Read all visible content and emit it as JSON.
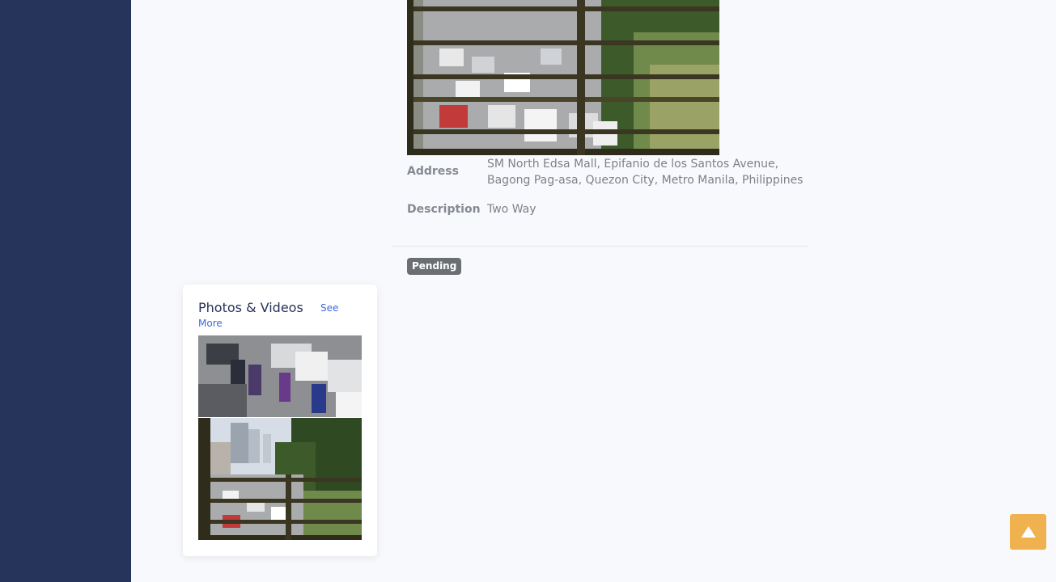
{
  "details": {
    "address_label": "Address",
    "address_value": "SM North Edsa Mall, Epifanio de los Santos Avenue, Bagong Pag-asa, Quezon City, Metro Manila, Philippines",
    "description_label": "Description",
    "description_value": "Two Way"
  },
  "status": {
    "label": "Pending"
  },
  "media": {
    "title": "Photos & Videos",
    "see_more": "See More"
  },
  "icons": {
    "scroll_top": "arrow-up-icon"
  },
  "colors": {
    "sidebar": "#26335a",
    "accent": "#3f6ad8",
    "badge": "#6c6f72",
    "scroll_button": "#f0b24f"
  }
}
